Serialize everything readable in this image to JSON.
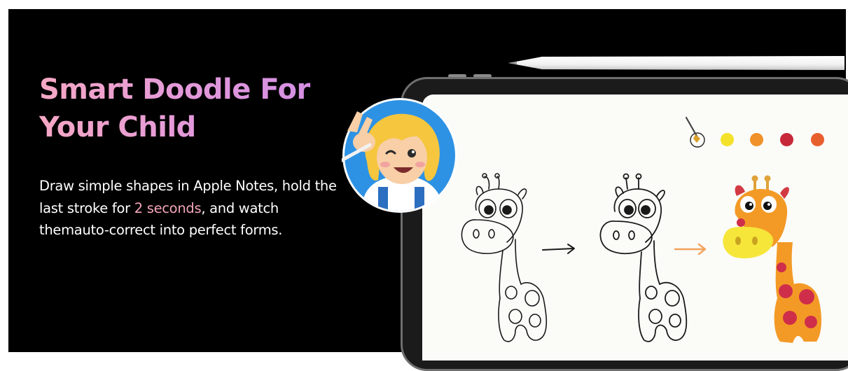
{
  "banner": {
    "headline_line1": "Smart Doodle For",
    "headline_line2": "Your Child",
    "body_part1": "Draw simple shapes in Apple Notes, hold the last stroke for ",
    "body_highlight": "2 seconds",
    "body_part2": ", and watch themauto-correct into perfect forms.",
    "colors": {
      "background": "#000000",
      "headline_gradient_start": "#f6a8c4",
      "headline_gradient_end": "#d08ce6",
      "highlight": "#f4a6b8"
    }
  },
  "illustration": {
    "palette_colors": [
      "#f4e22a",
      "#f0912a",
      "#c7293a",
      "#e85f2e"
    ],
    "icons": [
      "stylus-pencil",
      "tablet",
      "child-avatar",
      "paintbrush-icon",
      "arrow-right-icon",
      "giraffe-sketch",
      "giraffe-colored"
    ]
  }
}
